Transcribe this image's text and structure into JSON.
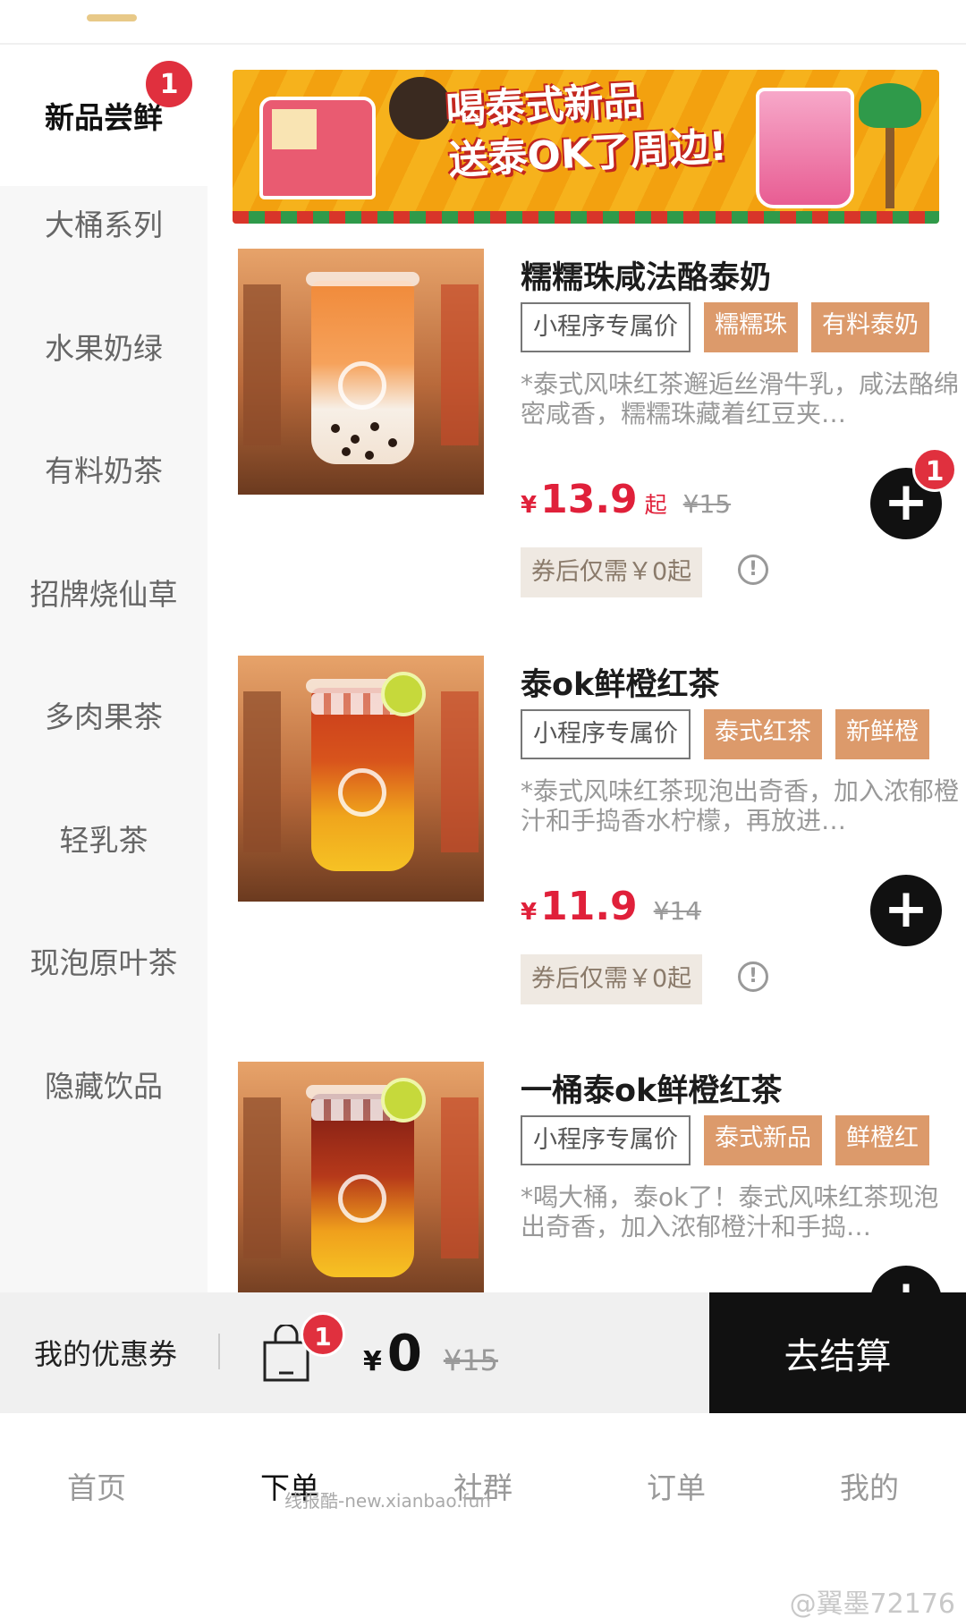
{
  "sidebar": {
    "items": [
      {
        "label": "新品尝鲜",
        "badge": "1",
        "active": true
      },
      {
        "label": "大桶系列"
      },
      {
        "label": "水果奶绿"
      },
      {
        "label": "有料奶茶"
      },
      {
        "label": "招牌烧仙草"
      },
      {
        "label": "多肉果茶"
      },
      {
        "label": "轻乳茶"
      },
      {
        "label": "现泡原叶茶"
      },
      {
        "label": "隐藏饮品"
      }
    ]
  },
  "banner": {
    "line1": "喝泰式新品",
    "line2": "送泰OK了周边!"
  },
  "products": [
    {
      "name": "糯糯珠咸法酪泰奶",
      "tags": [
        "小程序专属价",
        "糯糯珠",
        "有料泰奶"
      ],
      "desc": "*泰式风味红茶邂逅丝滑牛乳，咸法酪绵密咸香，糯糯珠藏着红豆夹…",
      "yen": "¥",
      "price": "13.9",
      "price_suffix": "起",
      "orig_price": "¥15",
      "coupon": "券后仅需￥0起",
      "cart_badge": "1"
    },
    {
      "name": "泰ok鲜橙红茶",
      "tags": [
        "小程序专属价",
        "泰式红茶",
        "新鲜橙"
      ],
      "desc": "*泰式风味红茶现泡出奇香，加入浓郁橙汁和手捣香水柠檬，再放进…",
      "yen": "¥",
      "price": "11.9",
      "orig_price": "¥14",
      "coupon": "券后仅需￥0起"
    },
    {
      "name": "一桶泰ok鲜橙红茶",
      "tags": [
        "小程序专属价",
        "泰式新品",
        "鲜橙红"
      ],
      "desc": "*喝大桶，泰ok了！泰式风味红茶现泡出奇香，加入浓郁橙汁和手捣…"
    }
  ],
  "cart": {
    "my_coupon": "我的优惠券",
    "badge": "1",
    "yen": "¥",
    "total": "0",
    "orig_total": "¥15",
    "checkout": "去结算"
  },
  "nav": {
    "items": [
      "首页",
      "下单",
      "社群",
      "订单",
      "我的"
    ],
    "active_index": 1
  },
  "watermark": "线报酷-new.xianbao.fun",
  "weibo_watermark": "@翼墨72176",
  "colors": {
    "accent": "#e0303e",
    "price": "#e0203a",
    "tag_fill": "#dc9a6b",
    "checkout_bg": "#111111"
  }
}
